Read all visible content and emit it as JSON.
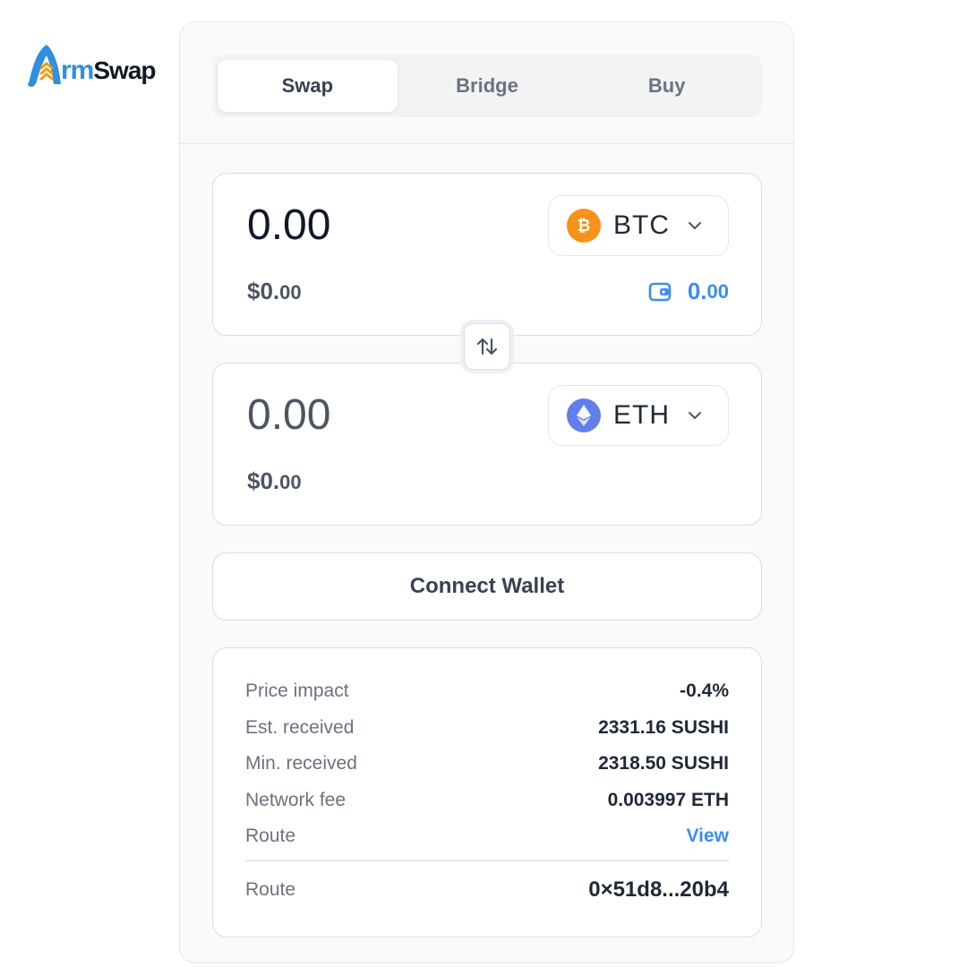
{
  "brand": {
    "logo_part1": "rm",
    "logo_part2": "Swap",
    "accent_color": "#2f8fe0"
  },
  "tabs": [
    {
      "label": "Swap",
      "active": true
    },
    {
      "label": "Bridge",
      "active": false
    },
    {
      "label": "Buy",
      "active": false
    }
  ],
  "from": {
    "amount": "0.00",
    "usd_main": "$0.",
    "usd_cents": "00",
    "token": "BTC",
    "token_icon": "bitcoin-icon",
    "token_color": "#f7931a",
    "balance_main": "0.",
    "balance_cents": "00"
  },
  "to": {
    "amount": "0.00",
    "usd_main": "$0.",
    "usd_cents": "00",
    "token": "ETH",
    "token_icon": "ethereum-icon",
    "token_color": "#627eea"
  },
  "connect_label": "Connect Wallet",
  "details": {
    "rows": [
      {
        "label": "Price impact",
        "value": "-0.4%"
      },
      {
        "label": "Est. received",
        "value": "2331.16 SUSHI"
      },
      {
        "label": "Min. received",
        "value": "2318.50 SUSHI"
      },
      {
        "label": "Network fee",
        "value": "0.003997 ETH"
      },
      {
        "label": "Route",
        "value": "View"
      }
    ],
    "footer": {
      "label": "Route",
      "value": "0×51d8...20b4"
    }
  }
}
